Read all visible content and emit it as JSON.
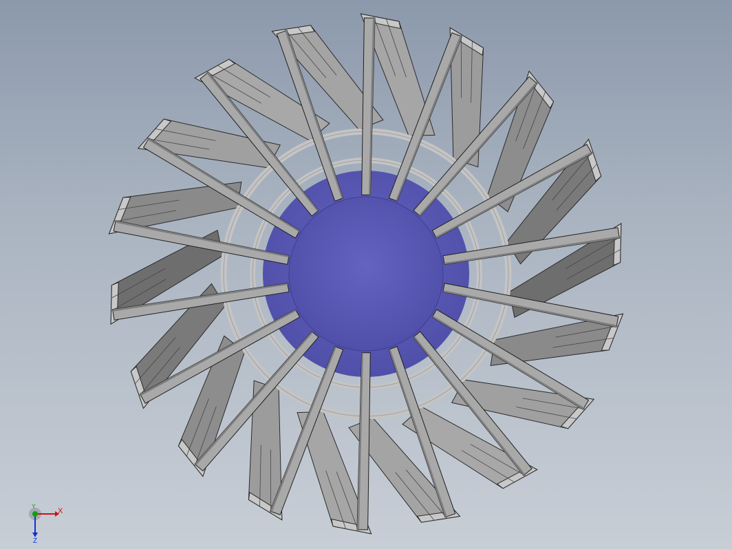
{
  "model": {
    "blade_count": 18,
    "hub_color": "#5a5ab4",
    "blade_color": "#a2a2a2",
    "blade_dark_color": "#6f6f6f",
    "ring_color": "#c4c4c4",
    "background_top": "#8c99ac",
    "background_bottom": "#c8ced6"
  },
  "triad": {
    "x_label": "X",
    "y_label": "Y",
    "z_label": "Z",
    "x_color": "#d01010",
    "y_color": "#10a010",
    "z_color": "#1030d0"
  }
}
